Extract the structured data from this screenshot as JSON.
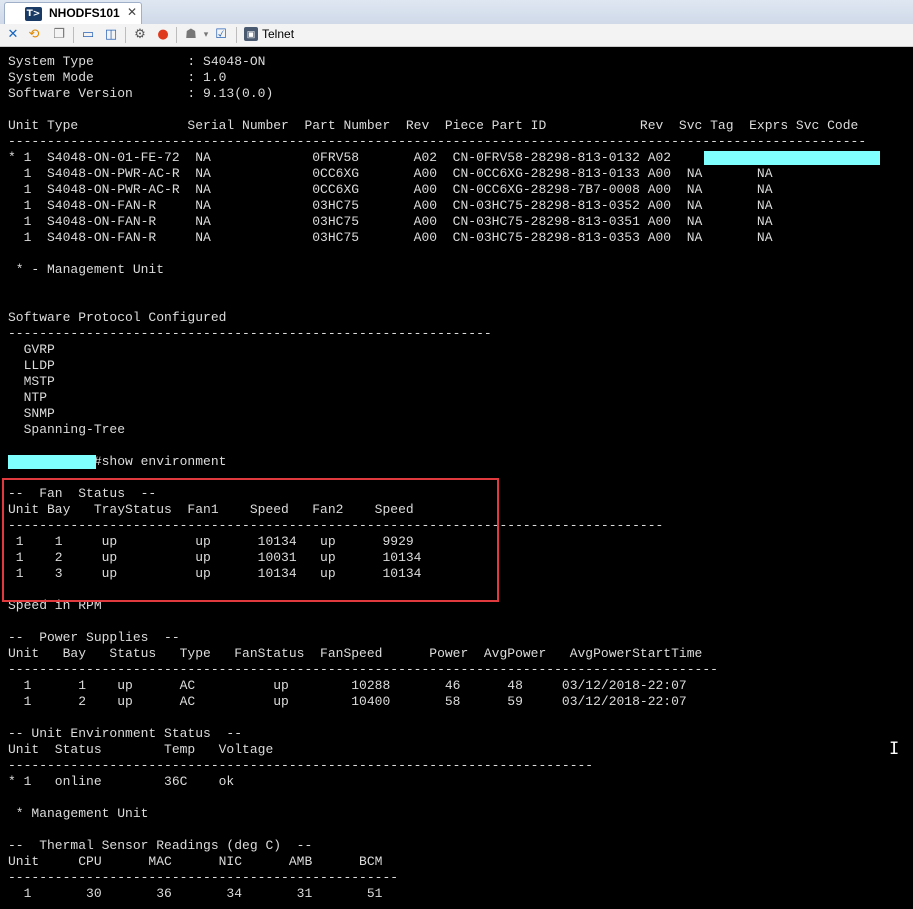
{
  "tab": {
    "logo_text": "T>",
    "title": "NHODFS101",
    "close": "✕"
  },
  "toolbar": {
    "icons": [
      "close-x-icon",
      "reconnect-icon",
      "copy-icon",
      "window-icon",
      "split-window-icon",
      "plugin-icon",
      "record-icon",
      "user-icon",
      "checklist-icon"
    ],
    "telnet_label": "Telnet"
  },
  "terminal": {
    "lines": [
      "System Type            : S4048-ON",
      "System Mode            : 1.0",
      "Software Version       : 9.13(0.0)",
      "",
      "Unit Type              Serial Number  Part Number  Rev  Piece Part ID            Rev  Svc Tag  Exprs Svc Code",
      "--------------------------------------------------------------------------------------------------------------",
      "* 1  S4048-ON-01-FE-72  NA             0FRV58       A02  CN-0FRV58-28298-813-0132 A02",
      "  1  S4048-ON-PWR-AC-R  NA             0CC6XG       A00  CN-0CC6XG-28298-813-0133 A00  NA       NA",
      "  1  S4048-ON-PWR-AC-R  NA             0CC6XG       A00  CN-0CC6XG-28298-7B7-0008 A00  NA       NA",
      "  1  S4048-ON-FAN-R     NA             03HC75       A00  CN-03HC75-28298-813-0352 A00  NA       NA",
      "  1  S4048-ON-FAN-R     NA             03HC75       A00  CN-03HC75-28298-813-0351 A00  NA       NA",
      "  1  S4048-ON-FAN-R     NA             03HC75       A00  CN-03HC75-28298-813-0353 A00  NA       NA",
      "",
      " * - Management Unit",
      "",
      "",
      "Software Protocol Configured",
      "--------------------------------------------------------------",
      "  GVRP",
      "  LLDP",
      "  MSTP",
      "  NTP",
      "  SNMP",
      "  Spanning-Tree",
      "",
      "           #show environment",
      "",
      "--  Fan  Status  --",
      "Unit Bay   TrayStatus  Fan1    Speed   Fan2    Speed",
      "------------------------------------------------------------------------------------",
      " 1    1     up          up      10134   up      9929",
      " 1    2     up          up      10031   up      10134",
      " 1    3     up          up      10134   up      10134",
      "",
      "Speed in RPM",
      "",
      "--  Power Supplies  --",
      "Unit   Bay   Status   Type   FanStatus  FanSpeed      Power  AvgPower   AvgPowerStartTime",
      "-------------------------------------------------------------------------------------------",
      "  1      1    up      AC          up        10288       46      48     03/12/2018-22:07",
      "  1      2    up      AC          up        10400       58      59     03/12/2018-22:07",
      "",
      "-- Unit Environment Status  --",
      "Unit  Status        Temp   Voltage",
      "---------------------------------------------------------------------------",
      "* 1   online        36C    ok",
      "",
      " * Management Unit",
      "",
      "--  Thermal Sensor Readings (deg C)  --",
      "Unit     CPU      MAC      NIC      AMB      BCM",
      "--------------------------------------------------",
      "  1       30       36       34       31       51"
    ]
  }
}
